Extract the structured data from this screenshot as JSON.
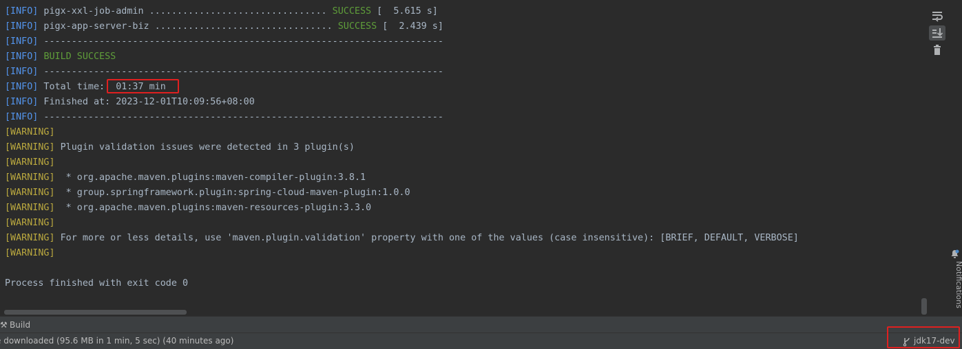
{
  "console": {
    "lines": [
      {
        "tag": "[INFO]",
        "text": " pigx-xxl-job-admin ................................ ",
        "success": "SUCCESS",
        "tail": " [  5.615 s]"
      },
      {
        "tag": "[INFO]",
        "text": " pigx-app-server-biz ................................ ",
        "success": "SUCCESS",
        "tail": " [  2.439 s]"
      },
      {
        "tag": "[INFO]",
        "text": " ------------------------------------------------------------------------"
      },
      {
        "tag": "[INFO]",
        "text": " ",
        "success": "BUILD SUCCESS"
      },
      {
        "tag": "[INFO]",
        "text": " ------------------------------------------------------------------------"
      },
      {
        "tag": "[INFO]",
        "text": " Total time:  01:37 min"
      },
      {
        "tag": "[INFO]",
        "text": " Finished at: 2023-12-01T10:09:56+08:00"
      },
      {
        "tag": "[INFO]",
        "text": " ------------------------------------------------------------------------"
      },
      {
        "tag": "[WARNING]",
        "text": ""
      },
      {
        "tag": "[WARNING]",
        "text": " Plugin validation issues were detected in 3 plugin(s)"
      },
      {
        "tag": "[WARNING]",
        "text": ""
      },
      {
        "tag": "[WARNING]",
        "text": "  * org.apache.maven.plugins:maven-compiler-plugin:3.8.1"
      },
      {
        "tag": "[WARNING]",
        "text": "  * group.springframework.plugin:spring-cloud-maven-plugin:1.0.0"
      },
      {
        "tag": "[WARNING]",
        "text": "  * org.apache.maven.plugins:maven-resources-plugin:3.3.0"
      },
      {
        "tag": "[WARNING]",
        "text": ""
      },
      {
        "tag": "[WARNING]",
        "text": " For more or less details, use 'maven.plugin.validation' property with one of the values (case insensitive): [BRIEF, DEFAULT, VERBOSE]"
      },
      {
        "tag": "[WARNING]",
        "text": ""
      },
      {
        "tag": "",
        "text": ""
      },
      {
        "tag": "",
        "text": "Process finished with exit code 0"
      }
    ]
  },
  "toolbar": {
    "icons": [
      "soft-wrap-icon",
      "scroll-to-end-icon",
      "clear-all-icon"
    ]
  },
  "notifications": {
    "label": "Notifications"
  },
  "tabs": {
    "build_label": "Build"
  },
  "status": {
    "text": "e downloaded (95.6 MB in 1 min, 5 sec) (40 minutes ago)",
    "branch": "jdk17-dev"
  },
  "colors": {
    "background": "#2b2b2b",
    "info_tag": "#5394ec",
    "warning_tag": "#bba93f",
    "success": "#5f9e3a",
    "highlight": "#e02020"
  }
}
